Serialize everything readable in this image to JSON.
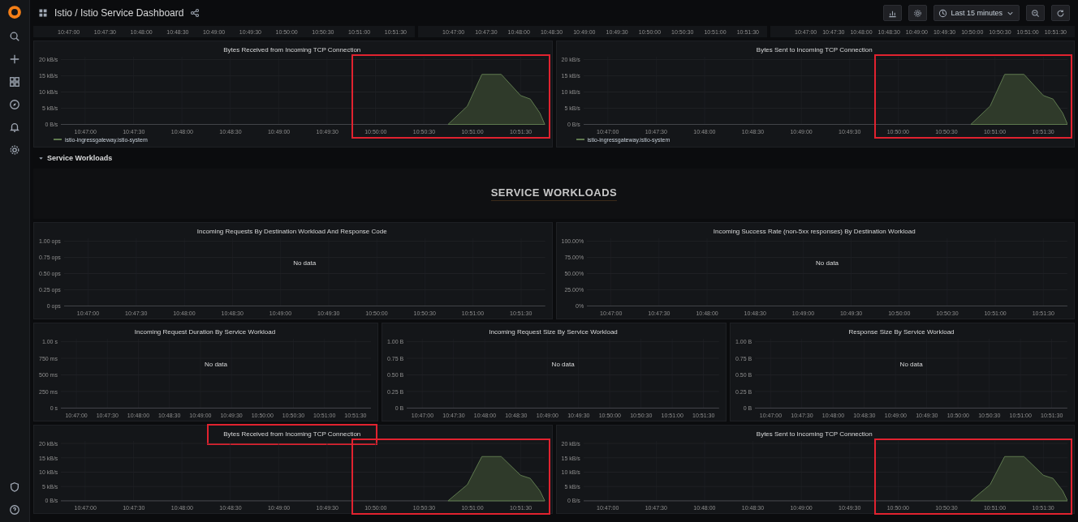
{
  "header": {
    "title": "Istio / Istio Service Dashboard",
    "time_range": "Last 15 minutes"
  },
  "top_strip": [
    {
      "xticks": [
        "10:47:00",
        "10:47:30",
        "10:48:00",
        "10:48:30",
        "10:49:00",
        "10:49:30",
        "10:50:00",
        "10:50:30",
        "10:51:00",
        "10:51:30"
      ]
    },
    {
      "xticks": [
        "10:47:00",
        "10:47:30",
        "10:48:00",
        "10:48:30",
        "10:49:00",
        "10:49:30",
        "10:50:00",
        "10:50:30",
        "10:51:00",
        "10:51:30"
      ]
    },
    {
      "xticks": [
        "10:47:00",
        "10:47:30",
        "10:48:00",
        "10:48:30",
        "10:49:00",
        "10:49:30",
        "10:50:00",
        "10:50:30",
        "10:51:00",
        "10:51:30"
      ]
    }
  ],
  "rows": [
    {
      "kind": "panels",
      "panels": [
        {
          "kind": "area",
          "title": "Bytes Received from Incoming TCP Connection",
          "highlight_plot": true,
          "yticks": [
            "20 kB/s",
            "15 kB/s",
            "10 kB/s",
            "5 kB/s",
            "0 B/s"
          ],
          "xticks": [
            "10:47:00",
            "10:47:30",
            "10:48:00",
            "10:48:30",
            "10:49:00",
            "10:49:30",
            "10:50:00",
            "10:50:30",
            "10:51:00",
            "10:51:30"
          ],
          "legend": "istio-ingressgateway.istio-system"
        },
        {
          "kind": "area",
          "title": "Bytes Sent to Incoming TCP Connection",
          "highlight_plot": true,
          "yticks": [
            "20 kB/s",
            "15 kB/s",
            "10 kB/s",
            "5 kB/s",
            "0 B/s"
          ],
          "xticks": [
            "10:47:00",
            "10:47:30",
            "10:48:00",
            "10:48:30",
            "10:49:00",
            "10:49:30",
            "10:50:00",
            "10:50:30",
            "10:51:00",
            "10:51:30"
          ],
          "legend": "istio-ingressgateway.istio-system"
        }
      ]
    },
    {
      "kind": "row_header",
      "title": "Service Workloads",
      "expanded": true
    },
    {
      "kind": "text",
      "text": "SERVICE WORKLOADS"
    },
    {
      "kind": "panels",
      "panels": [
        {
          "kind": "empty",
          "title": "Incoming Requests By Destination Workload And Response Code",
          "message": "No data",
          "yticks": [
            "1.00 ops",
            "0.75 ops",
            "0.50 ops",
            "0.25 ops",
            "0 ops"
          ],
          "xticks": [
            "10:47:00",
            "10:47:30",
            "10:48:00",
            "10:48:30",
            "10:49:00",
            "10:49:30",
            "10:50:00",
            "10:50:30",
            "10:51:00",
            "10:51:30"
          ]
        },
        {
          "kind": "empty",
          "title": "Incoming Success Rate (non-5xx responses) By Destination Workload",
          "message": "No data",
          "yticks": [
            "100.00%",
            "75.00%",
            "50.00%",
            "25.00%",
            "0%"
          ],
          "xticks": [
            "10:47:00",
            "10:47:30",
            "10:48:00",
            "10:48:30",
            "10:49:00",
            "10:49:30",
            "10:50:00",
            "10:50:30",
            "10:51:00",
            "10:51:30"
          ]
        }
      ]
    },
    {
      "kind": "panels",
      "panels": [
        {
          "kind": "empty",
          "title": "Incoming Request Duration By Service Workload",
          "message": "No data",
          "yticks": [
            "1.00 s",
            "750 ms",
            "500 ms",
            "250 ms",
            "0 s"
          ],
          "xticks": [
            "10:47:00",
            "10:47:30",
            "10:48:00",
            "10:48:30",
            "10:49:00",
            "10:49:30",
            "10:50:00",
            "10:50:30",
            "10:51:00",
            "10:51:30"
          ]
        },
        {
          "kind": "empty",
          "title": "Incoming Request Size By Service Workload",
          "message": "No data",
          "yticks": [
            "1.00 B",
            "0.75 B",
            "0.50 B",
            "0.25 B",
            "0 B"
          ],
          "xticks": [
            "10:47:00",
            "10:47:30",
            "10:48:00",
            "10:48:30",
            "10:49:00",
            "10:49:30",
            "10:50:00",
            "10:50:30",
            "10:51:00",
            "10:51:30"
          ]
        },
        {
          "kind": "empty",
          "title": "Response Size By Service Workload",
          "message": "No data",
          "yticks": [
            "1.00 B",
            "0.75 B",
            "0.50 B",
            "0.25 B",
            "0 B"
          ],
          "xticks": [
            "10:47:00",
            "10:47:30",
            "10:48:00",
            "10:48:30",
            "10:49:00",
            "10:49:30",
            "10:50:00",
            "10:50:30",
            "10:51:00",
            "10:51:30"
          ]
        }
      ]
    },
    {
      "kind": "panels",
      "panels": [
        {
          "kind": "area",
          "title": "Bytes Received from Incoming TCP Connection",
          "highlight_title": true,
          "highlight_plot": true,
          "yticks": [
            "20 kB/s",
            "15 kB/s",
            "10 kB/s",
            "5 kB/s",
            "0 B/s"
          ],
          "xticks": [
            "10:47:00",
            "10:47:30",
            "10:48:00",
            "10:48:30",
            "10:49:00",
            "10:49:30",
            "10:50:00",
            "10:50:30",
            "10:51:00",
            "10:51:30"
          ]
        },
        {
          "kind": "area",
          "title": "Bytes Sent to Incoming TCP Connection",
          "highlight_plot": true,
          "yticks": [
            "20 kB/s",
            "15 kB/s",
            "10 kB/s",
            "5 kB/s",
            "0 B/s"
          ],
          "xticks": [
            "10:47:00",
            "10:47:30",
            "10:48:00",
            "10:48:30",
            "10:49:00",
            "10:49:30",
            "10:50:00",
            "10:50:30",
            "10:51:00",
            "10:51:30"
          ]
        }
      ]
    }
  ]
}
